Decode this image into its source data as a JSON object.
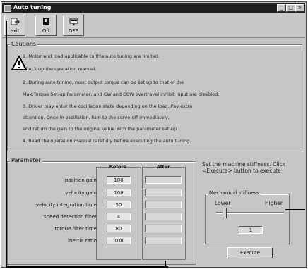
{
  "window": {
    "title": "Auto tuning",
    "controls": {
      "minimize": "_",
      "maximize": "□",
      "close": "×"
    }
  },
  "toolbar": {
    "buttons": [
      {
        "label": "exit",
        "icon": "exit-icon"
      },
      {
        "label": "Off",
        "icon": "off-icon"
      },
      {
        "label": "DEP",
        "icon": "dep-icon"
      }
    ]
  },
  "cautions": {
    "title": "Cautions",
    "icon": "warning-icon",
    "lines": [
      "1. Motor and load applicable to this auto tuning are limited.",
      "Check up the operation manual.",
      "2. During auto tuning, max. output torque can be set up to that of the",
      "Max.Torque Set-up Parameter, and CW and CCW overtravel inhibit input are disabled.",
      "3. Driver may enter the oscillation state depending on the load. Pay extra",
      "attention. Once in oscillation, turn to the servo-off immediately,",
      "and return the gain to the original value with the parameter set-up.",
      "4. Read the operation manual carefully before executing the auto tuning."
    ]
  },
  "parameter": {
    "title": "Parameter",
    "before_header": "Before",
    "after_header": "After",
    "rows": [
      {
        "label": "position gain",
        "before": "108",
        "after": ""
      },
      {
        "label": "velocity gain",
        "before": "108",
        "after": ""
      },
      {
        "label": "velocity integration time",
        "before": "50",
        "after": ""
      },
      {
        "label": "speed detection filter",
        "before": "4",
        "after": ""
      },
      {
        "label": "torque filter time",
        "before": "80",
        "after": ""
      },
      {
        "label": "inertia ratio",
        "before": "108",
        "after": ""
      }
    ]
  },
  "stiffness": {
    "instruction": "Set the machine stiffness. Click <Execute> button to execute",
    "group_title": "Mechanical stiffness",
    "lower": "Lower",
    "higher": "Higher",
    "value": "1",
    "execute_label": "Execute"
  }
}
